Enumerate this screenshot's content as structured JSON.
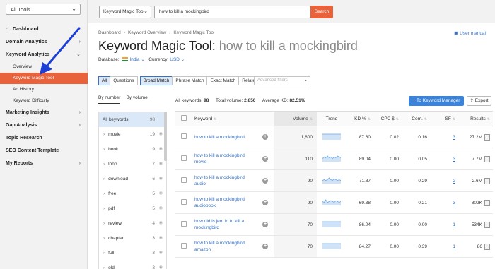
{
  "sidebar": {
    "tools_select": "All Tools",
    "items": [
      {
        "label": "Dashboard",
        "icon": "home-icon"
      },
      {
        "label": "Domain Analytics",
        "arrow": "›"
      },
      {
        "label": "Keyword Analytics",
        "arrow": "⌄"
      }
    ],
    "sub_items": [
      "Overview",
      "Keyword Magic Tool",
      "Ad History",
      "Keyword Difficulty"
    ],
    "items_after": [
      {
        "label": "Marketing Insights",
        "arrow": "›"
      },
      {
        "label": "Gap Analysis",
        "arrow": "›"
      },
      {
        "label": "Topic Research",
        "arrow": ""
      },
      {
        "label": "SEO Content Template",
        "arrow": ""
      },
      {
        "label": "My Reports",
        "arrow": "›"
      }
    ]
  },
  "topbar": {
    "tool_select": "Keyword Magic Tool",
    "search_value": "how to kill a mockingbird",
    "search_button": "Search"
  },
  "breadcrumb": [
    "Dashboard",
    "Keyword Overview",
    "Keyword Magic Tool"
  ],
  "user_manual": "User manual",
  "title": {
    "main": "Keyword Magic Tool:",
    "keyword": "how to kill a mockingbird"
  },
  "database": {
    "label": "Database:",
    "value": "India",
    "currency_label": "Currency:",
    "currency": "USD"
  },
  "filters": {
    "group1": [
      "All",
      "Questions"
    ],
    "group2": [
      "Broad Match",
      "Phrase Match",
      "Exact Match",
      "Related"
    ],
    "advanced": "Advanced filters"
  },
  "groups": {
    "by_number": "By number",
    "by_volume": "By volume",
    "all_label": "All keywords",
    "all_count": "98",
    "items": [
      {
        "label": "movie",
        "count": "19"
      },
      {
        "label": "book",
        "count": "9"
      },
      {
        "label": "lono",
        "count": "7"
      },
      {
        "label": "download",
        "count": "6"
      },
      {
        "label": "free",
        "count": "5"
      },
      {
        "label": "pdf",
        "count": "5"
      },
      {
        "label": "review",
        "count": "4"
      },
      {
        "label": "chapter",
        "count": "3"
      },
      {
        "label": "full",
        "count": "3"
      },
      {
        "label": "old",
        "count": "3"
      }
    ]
  },
  "stats": {
    "all_keywords_label": "All keywords:",
    "all_keywords": "98",
    "total_volume_label": "Total volume:",
    "total_volume": "2,850",
    "avg_kd_label": "Average KD:",
    "avg_kd": "82.51%"
  },
  "actions": {
    "to_keyword_manager": "To Keyword Manager",
    "export": "Export"
  },
  "table": {
    "headers": [
      "Keyword",
      "Volume",
      "Trend",
      "KD %",
      "CPC $",
      "Com.",
      "SF",
      "Results"
    ],
    "rows": [
      {
        "keyword": "how to kill a mockingbird",
        "volume": "1,600",
        "kd": "87.60",
        "cpc": "0.02",
        "com": "0.16",
        "sf": "3",
        "results": "27.2M",
        "trend": [
          3,
          3,
          3,
          3,
          3,
          3,
          3,
          3,
          3,
          3,
          3,
          3
        ]
      },
      {
        "keyword": "how to kill a mockingbird movie",
        "volume": "110",
        "kd": "89.04",
        "cpc": "0.00",
        "com": "0.05",
        "sf": "3",
        "results": "7.7M",
        "trend": [
          2,
          4,
          3,
          5,
          3,
          4,
          2,
          4,
          3,
          5,
          4,
          3
        ]
      },
      {
        "keyword": "how to kill a mockingbird audio",
        "volume": "90",
        "kd": "71.87",
        "cpc": "0.00",
        "com": "0.29",
        "sf": "2",
        "results": "2.6M",
        "trend": [
          2,
          3,
          2,
          3,
          5,
          3,
          2,
          4,
          3,
          2,
          3,
          2
        ]
      },
      {
        "keyword": "how to kill a mockingbird audiobook",
        "volume": "90",
        "kd": "69.38",
        "cpc": "0.00",
        "com": "0.21",
        "sf": "3",
        "results": "802K",
        "trend": [
          3,
          2,
          5,
          2,
          3,
          4,
          3,
          2,
          4,
          3,
          2,
          3
        ]
      },
      {
        "keyword": "how old is jem in to kill a mockingbird",
        "volume": "70",
        "kd": "86.04",
        "cpc": "0.00",
        "com": "0.00",
        "sf": "1",
        "results": "534K",
        "trend": [
          3,
          3,
          3,
          3,
          3,
          3,
          3,
          3,
          3,
          3,
          3,
          3
        ]
      },
      {
        "keyword": "how to kill a mockingbird amazon",
        "volume": "70",
        "kd": "84.27",
        "cpc": "0.00",
        "com": "0.39",
        "sf": "1",
        "results": "86",
        "trend": [
          3,
          3,
          3,
          3,
          3,
          3,
          3,
          3,
          3,
          3,
          3,
          3
        ]
      }
    ]
  },
  "colors": {
    "accent": "#e8623c",
    "link": "#3672c4",
    "primary_button": "#3a83d8",
    "annotation_arrow": "#1b3fd6"
  }
}
